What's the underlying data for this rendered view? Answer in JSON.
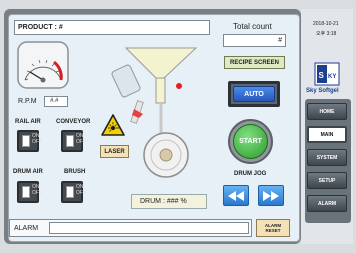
{
  "header": {
    "product_label": "PRODUCT : #",
    "total_count_label": "Total count",
    "total_count_value": "#"
  },
  "gauge": {
    "rpm_label": "R.P.M",
    "rpm_value": "#.#"
  },
  "switches": [
    {
      "label": "RAIL AIR",
      "on": "ON",
      "off": "OFF"
    },
    {
      "label": "CONVEYOR",
      "on": "ON",
      "off": "OFF"
    },
    {
      "label": "DRUM AIR",
      "on": "ON",
      "off": "OFF"
    },
    {
      "label": "BRUSH",
      "on": "ON",
      "off": "OFF"
    }
  ],
  "laser": {
    "label": "LASER"
  },
  "drum": {
    "readout": "DRUM : ### %"
  },
  "controls": {
    "recipe": "RECIPE SCREEN",
    "auto": "AUTO",
    "start": "START",
    "drum_jog": "DRUM JOG"
  },
  "alarm": {
    "label": "ALARM",
    "value": "",
    "reset": "ALARM RESET"
  },
  "sidebar": {
    "date": "2018-10-21",
    "time": "오후 3:18",
    "brand": "Sky Softgel",
    "items": [
      {
        "label": "HOME"
      },
      {
        "label": "MAIN"
      },
      {
        "label": "SYSTEM"
      },
      {
        "label": "SETUP"
      },
      {
        "label": "ALARM"
      }
    ]
  },
  "colors": {
    "panel": "#e6f0f6",
    "auto_blue": "#2e6fd0",
    "start_green": "#3aa83a",
    "jog_blue": "#3a86d8",
    "funnel": "#f3f3cf"
  }
}
